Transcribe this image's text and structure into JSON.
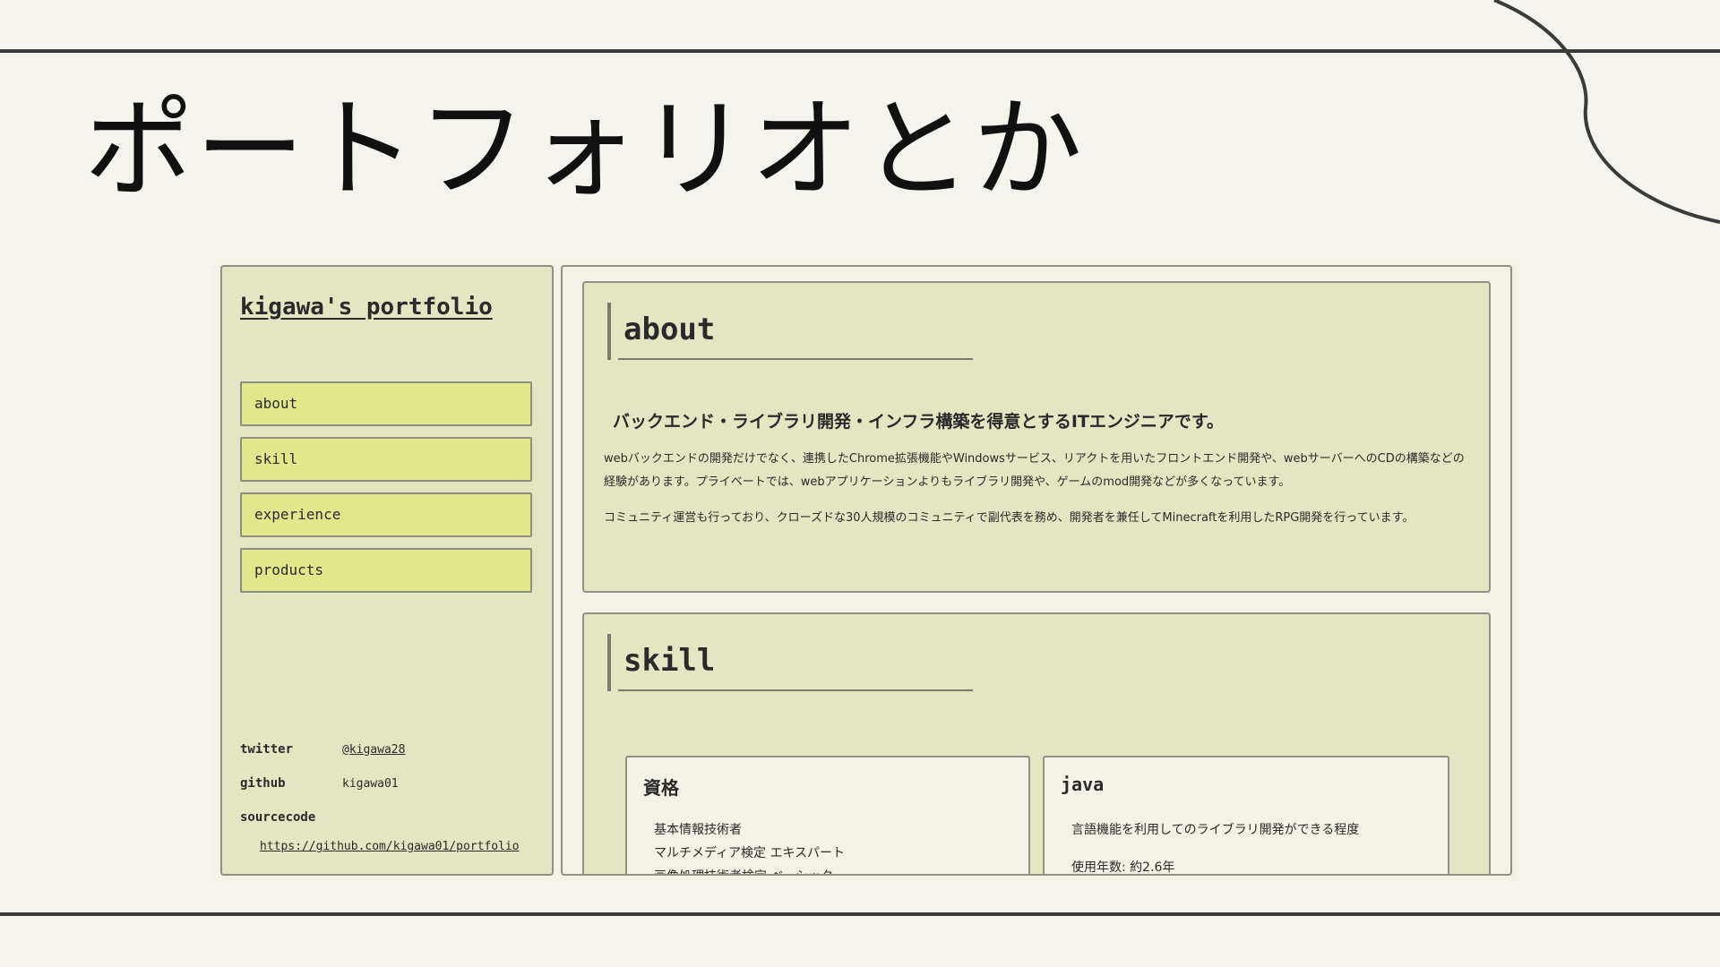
{
  "slide": {
    "title": "ポートフォリオとか"
  },
  "sidebar": {
    "site_title": "kigawa's portfolio",
    "nav": [
      {
        "label": "about"
      },
      {
        "label": "skill"
      },
      {
        "label": "experience"
      },
      {
        "label": "products"
      }
    ],
    "links": {
      "twitter_label": "twitter",
      "twitter_value": "@kigawa28",
      "github_label": "github",
      "github_value": "kigawa01",
      "source_label": "sourcecode",
      "source_url": "https://github.com/kigawa01/portfolio"
    }
  },
  "main": {
    "about": {
      "heading": "about",
      "lead": "バックエンド・ライブラリ開発・インフラ構築を得意とするITエンジニアです。",
      "p1": "webバックエンドの開発だけでなく、連携したChrome拡張機能やWindowsサービス、リアクトを用いたフロントエンド開発や、webサーバーへのCDの構築などの経験があります。プライベートでは、webアプリケーションよりもライブラリ開発や、ゲームのmod開発などが多くなっています。",
      "p2": "コミュニティ運営も行っており、クローズドな30人規模のコミュニティで副代表を務め、開発者を兼任してMinecraftを利用したRPG開発を行っています。"
    },
    "skill": {
      "heading": "skill",
      "cards": [
        {
          "title": "資格",
          "items": [
            "基本情報技術者",
            "マルチメディア検定 エキスパート",
            "画像処理技術者検定 ベーシック"
          ]
        },
        {
          "title": "java",
          "text": "言語機能を利用してのライブラリ開発ができる程度",
          "meta": "使用年数: 約2.6年"
        }
      ]
    }
  },
  "colors": {
    "page_bg": "#f5f3ee",
    "panel_bg": "#e4e5c2",
    "nav_bg": "#e1e88c",
    "card_bg": "#f4f1e6",
    "border": "#8f8f86",
    "rule": "#3a3a3a"
  }
}
